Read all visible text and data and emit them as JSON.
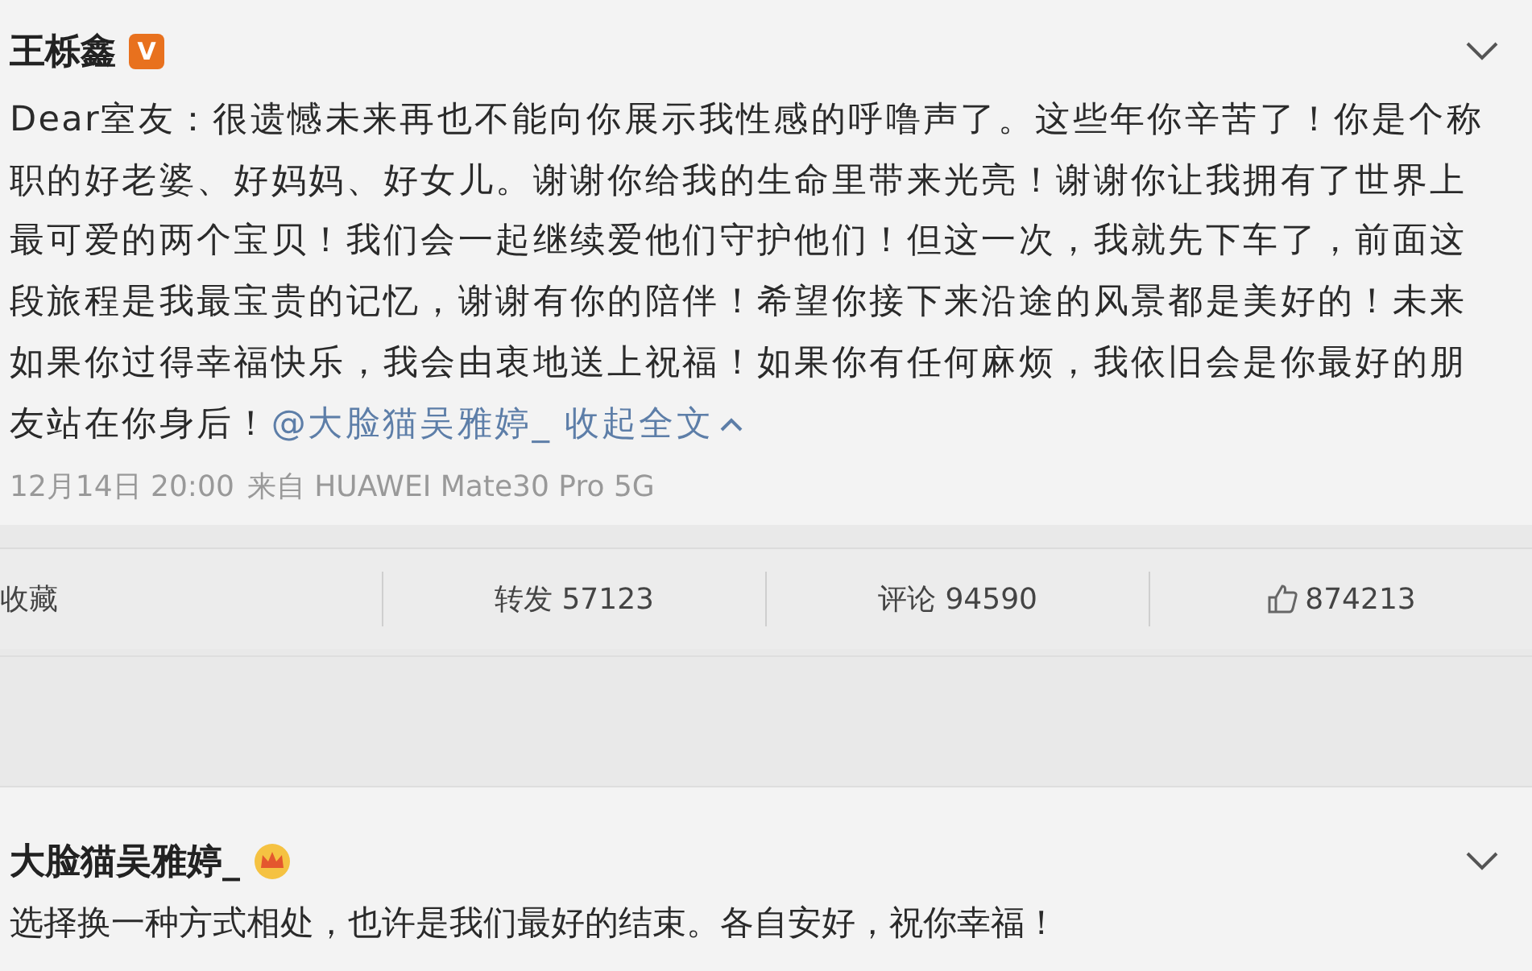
{
  "post": {
    "author": "王栎鑫",
    "badge": "V",
    "text": "Dear室友：很遗憾未来再也不能向你展示我性感的呼噜声了。这些年你辛苦了！你是个称职的好老婆、好妈妈、好女儿。谢谢你给我的生命里带来光亮！谢谢你让我拥有了世界上最可爱的两个宝贝！我们会一起继续爱他们守护他们！但这一次，我就先下车了，前面这段旅程是我最宝贵的记忆，谢谢有你的陪伴！希望你接下来沿途的风景都是美好的！未来如果你过得幸福快乐，我会由衷地送上祝福！如果你有任何麻烦，我依旧会是你最好的朋友站在你身后！",
    "mention": "@大脸猫吴雅婷_",
    "collapse": "收起全文",
    "time": "12月14日 20:00",
    "source": "来自 HUAWEI Mate30 Pro 5G"
  },
  "actions": [
    {
      "kind": "text",
      "label": "收藏"
    },
    {
      "kind": "text",
      "label": "转发 57123"
    },
    {
      "kind": "text",
      "label": "评论 94590"
    },
    {
      "kind": "like",
      "label": "874213"
    }
  ],
  "comment": {
    "author": "大脸猫吴雅婷_",
    "text": "选择换一种方式相处，也许是我们最好的结束。各自安好，祝你幸福！"
  }
}
